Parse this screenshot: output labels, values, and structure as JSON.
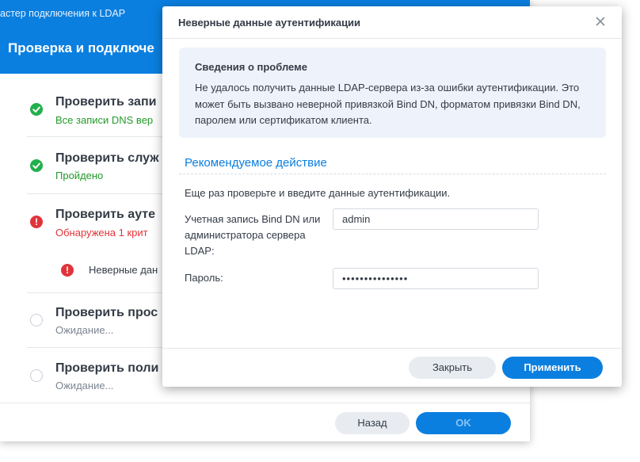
{
  "wizard": {
    "title": "астер подключения к LDAP",
    "heading": "Проверка и подключе",
    "steps": [
      {
        "title": "Проверить запи",
        "status": "Все записи DNS вер",
        "state": "ok"
      },
      {
        "title": "Проверить служ",
        "status": "Пройдено",
        "state": "ok"
      },
      {
        "title": "Проверить ауте",
        "status": "Обнаружена 1 крит",
        "state": "error"
      },
      {
        "title": "Проверить прос",
        "status": "Ожидание...",
        "state": "waiting"
      },
      {
        "title": "Проверить поли",
        "status": "Ожидание...",
        "state": "waiting"
      }
    ],
    "sub_item": "Неверные дан",
    "back_button": "Назад",
    "ok_button": "OK"
  },
  "dialog": {
    "title": "Неверные данные аутентификации",
    "close_icon": "×",
    "problem": {
      "title": "Сведения о проблеме",
      "text": "Не удалось получить данные LDAP-сервера из-за ошибки аутентификации. Это может быть вызвано неверной привязкой Bind DN, форматом привязки Bind DN, паролем или сертификатом клиента."
    },
    "recommended": {
      "heading": "Рекомендуемое действие",
      "text": "Еще раз проверьте и введите данные аутентификации."
    },
    "fields": {
      "bind_dn_label": "Учетная запись Bind DN или администратора сервера LDAP:",
      "bind_dn_value": "admin",
      "password_label": "Пароль:",
      "password_value": "•••••••••••••••"
    },
    "close_button": "Закрыть",
    "apply_button": "Применить"
  },
  "colors": {
    "accent": "#0a7fe0",
    "success": "#22b04c",
    "error": "#e1343a"
  }
}
